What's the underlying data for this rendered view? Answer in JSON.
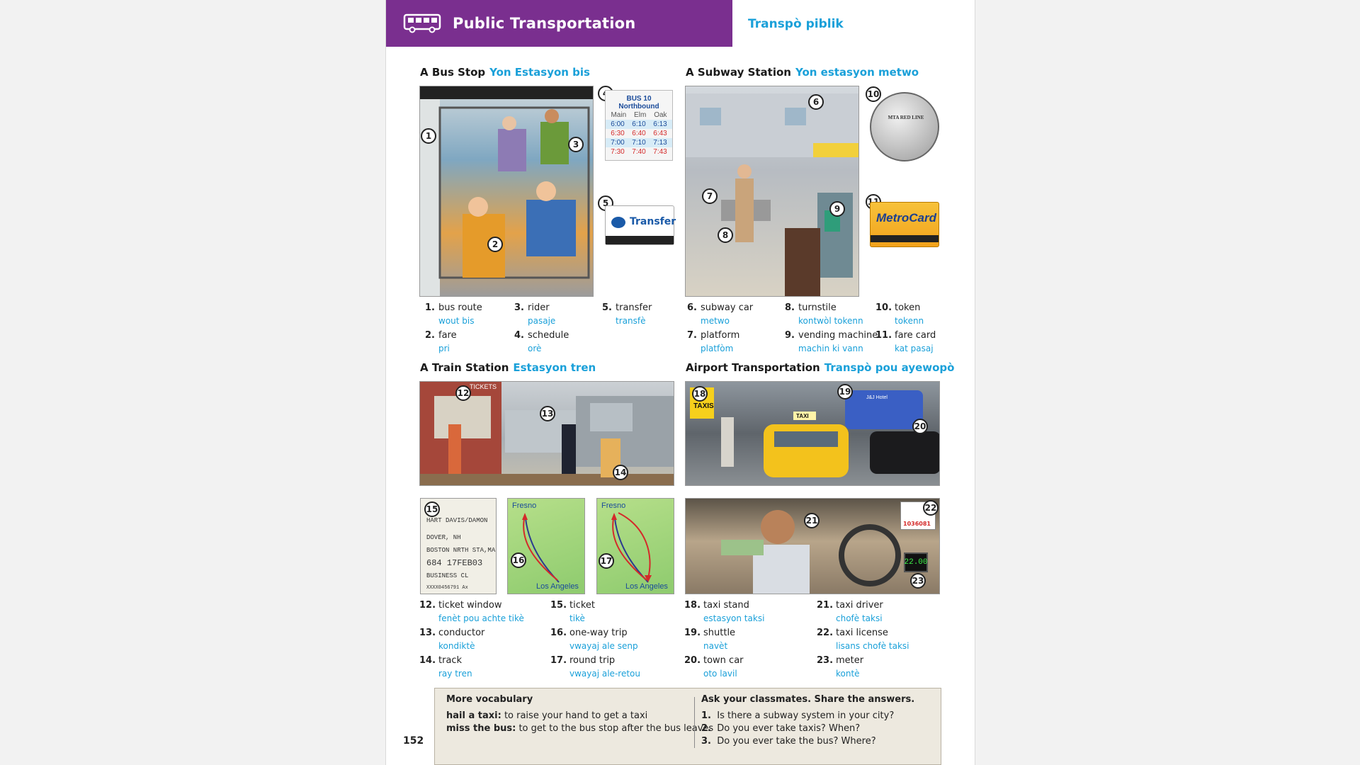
{
  "header": {
    "title": "Public Transportation",
    "subtitle": "Transpò piblik"
  },
  "sections": {
    "bus": {
      "title": "A Bus Stop",
      "translation": "Yon Estasyon bis"
    },
    "subway": {
      "title": "A Subway Station",
      "translation": "Yon estasyon metwo"
    },
    "train": {
      "title": "A Train Station",
      "translation": "Estasyon tren"
    },
    "airport": {
      "title": "Airport Transportation",
      "translation": "Transpò pou ayewopò"
    }
  },
  "vocab": [
    {
      "n": "1.",
      "en": "bus route",
      "kr": "wout bis"
    },
    {
      "n": "2.",
      "en": "fare",
      "kr": "pri"
    },
    {
      "n": "3.",
      "en": "rider",
      "kr": "pasaje"
    },
    {
      "n": "4.",
      "en": "schedule",
      "kr": "orè"
    },
    {
      "n": "5.",
      "en": "transfer",
      "kr": "transfè"
    },
    {
      "n": "6.",
      "en": "subway car",
      "kr": "metwo"
    },
    {
      "n": "7.",
      "en": "platform",
      "kr": "platfòm"
    },
    {
      "n": "8.",
      "en": "turnstile",
      "kr": "kontwòl tokenn"
    },
    {
      "n": "9.",
      "en": "vending machine",
      "kr": "machin ki vann"
    },
    {
      "n": "10.",
      "en": "token",
      "kr": "tokenn"
    },
    {
      "n": "11.",
      "en": "fare card",
      "kr": "kat pasaj"
    },
    {
      "n": "12.",
      "en": "ticket window",
      "kr": "fenèt pou achte tikè"
    },
    {
      "n": "13.",
      "en": "conductor",
      "kr": "kondiktè"
    },
    {
      "n": "14.",
      "en": "track",
      "kr": "ray tren"
    },
    {
      "n": "15.",
      "en": "ticket",
      "kr": "tikè"
    },
    {
      "n": "16.",
      "en": "one-way trip",
      "kr": "vwayaj ale senp"
    },
    {
      "n": "17.",
      "en": "round trip",
      "kr": "vwayaj ale-retou"
    },
    {
      "n": "18.",
      "en": "taxi stand",
      "kr": "estasyon taksi"
    },
    {
      "n": "19.",
      "en": "shuttle",
      "kr": "navèt"
    },
    {
      "n": "20.",
      "en": "town car",
      "kr": "oto lavil"
    },
    {
      "n": "21.",
      "en": "taxi driver",
      "kr": "chofè taksi"
    },
    {
      "n": "22.",
      "en": "taxi license",
      "kr": "lisans chofè taksi"
    },
    {
      "n": "23.",
      "en": "meter",
      "kr": "kontè"
    }
  ],
  "labels": [
    "1",
    "2",
    "3",
    "4",
    "5",
    "6",
    "7",
    "8",
    "9",
    "10",
    "11",
    "12",
    "13",
    "14",
    "15",
    "16",
    "17",
    "18",
    "19",
    "20",
    "21",
    "22",
    "23"
  ],
  "schedule": {
    "title": "BUS 10 Northbound",
    "head": [
      "Main",
      "Elm",
      "Oak"
    ],
    "rows": [
      [
        "6:00",
        "6:10",
        "6:13"
      ],
      [
        "6:30",
        "6:40",
        "6:43"
      ],
      [
        "7:00",
        "7:10",
        "7:13"
      ],
      [
        "7:30",
        "7:40",
        "7:43"
      ]
    ]
  },
  "transfer_card": {
    "label": "Transfer"
  },
  "token_text": "MTA RED LINE",
  "metrocard": "MetroCard",
  "ticket_lines": [
    "HART DAVIS/DAMON",
    "DOVER, NH",
    "BOSTON NRTH STA,MA",
    "684  17FEB03",
    "BUSINESS CL",
    "XXXX0456791  Ax"
  ],
  "maps": {
    "from": "Fresno",
    "to": "Los Angeles"
  },
  "signs": {
    "taxis": "TAXIS",
    "taxi_roof": "TAXI",
    "hotel": "J&J Hotel",
    "tickets": "TICKETS"
  },
  "license_number": "1036081",
  "meter_reading": "22.00",
  "more_vocab": {
    "title": "More vocabulary",
    "items": [
      {
        "term": "hail a taxi:",
        "def": "to raise your hand to get a taxi"
      },
      {
        "term": "miss the bus:",
        "def": "to get to the bus stop after the bus leaves"
      }
    ]
  },
  "ask": {
    "title": "Ask your classmates. Share the answers.",
    "items": [
      {
        "n": "1.",
        "q": "Is there a subway system in your city?"
      },
      {
        "n": "2.",
        "q": "Do you ever take taxis? When?"
      },
      {
        "n": "3.",
        "q": "Do you ever take the bus? Where?"
      }
    ]
  },
  "page_number": "152",
  "colors": {
    "header": "#7a2f8f",
    "accent": "#1aa0d9"
  }
}
